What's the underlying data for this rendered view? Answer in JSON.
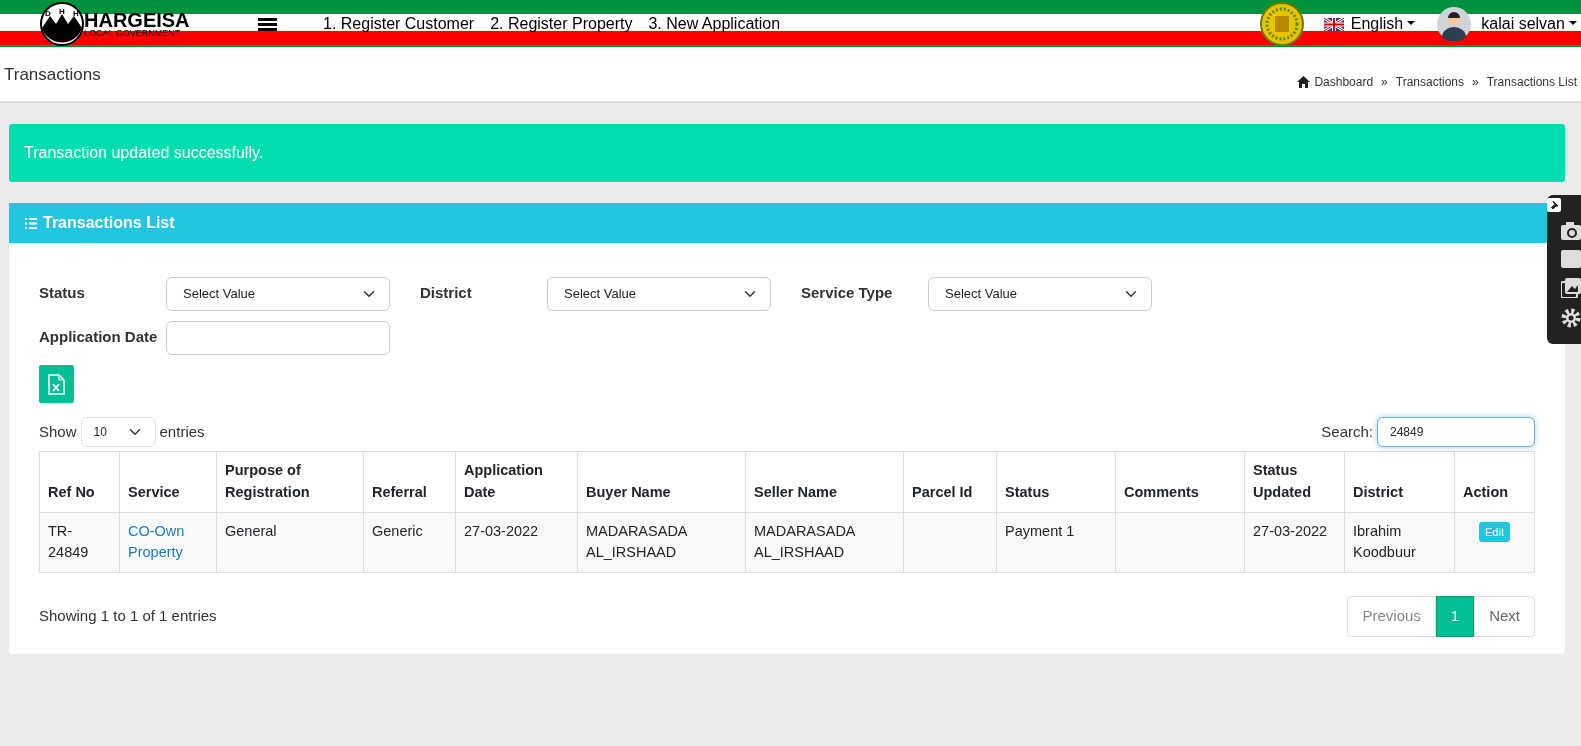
{
  "header": {
    "logo_title": "HARGEISA",
    "logo_subtitle": "LOCAL GOVERNMENT",
    "logo_letters": [
      "D",
      "H",
      "H"
    ],
    "nav_links": [
      "1. Register Customer",
      "2. Register Property",
      "3. New Application"
    ],
    "language": "English",
    "user": "kalai selvan"
  },
  "page_title": "Transactions",
  "breadcrumb": [
    "Dashboard",
    "Transactions",
    "Transactions List"
  ],
  "breadcrumb_separator": "»",
  "alert": "Transaction updated successfully.",
  "card": {
    "title": "Transactions List",
    "filters": [
      {
        "label": "Status",
        "kind": "select",
        "value": "Select Value"
      },
      {
        "label": "District",
        "kind": "select",
        "value": "Select Value"
      },
      {
        "label": "Service Type",
        "kind": "select",
        "value": "Select Value"
      },
      {
        "label": "Application Date",
        "kind": "input"
      }
    ],
    "length": {
      "before": "Show",
      "value": "10",
      "after": "entries"
    },
    "search": {
      "label": "Search:",
      "value": "24849"
    },
    "table": {
      "columns": [
        "Ref No",
        "Service",
        "Purpose of Registration",
        "Referral",
        "Application Date",
        "Buyer Name",
        "Seller Name",
        "Parcel Id",
        "Status",
        "Comments",
        "Status Updated",
        "District",
        "Action"
      ],
      "rows": [
        {
          "cells": [
            {
              "kind": "text",
              "text": "TR-24849"
            },
            {
              "kind": "link",
              "text": "CO-Own Property"
            },
            {
              "kind": "text",
              "text": "General"
            },
            {
              "kind": "text",
              "text": "Generic"
            },
            {
              "kind": "text",
              "text": "27-03-2022"
            },
            {
              "kind": "text",
              "text": "MADARASADA AL_IRSHAAD"
            },
            {
              "kind": "text",
              "text": "MADARASADA AL_IRSHAAD"
            },
            {
              "kind": "text",
              "text": ""
            },
            {
              "kind": "text",
              "text": "Payment 1"
            },
            {
              "kind": "text",
              "text": ""
            },
            {
              "kind": "text",
              "text": "27-03-2022"
            },
            {
              "kind": "text",
              "text": "Ibrahim Koodbuur"
            },
            {
              "kind": "button",
              "text": "Edit"
            }
          ]
        }
      ]
    },
    "info": "Showing 1 to 1 of 1 entries",
    "pagination": [
      {
        "label": "Previous",
        "selected": false,
        "disabled": true
      },
      {
        "label": "1",
        "selected": true,
        "disabled": false
      },
      {
        "label": "Next",
        "selected": false,
        "disabled": false
      }
    ]
  }
}
